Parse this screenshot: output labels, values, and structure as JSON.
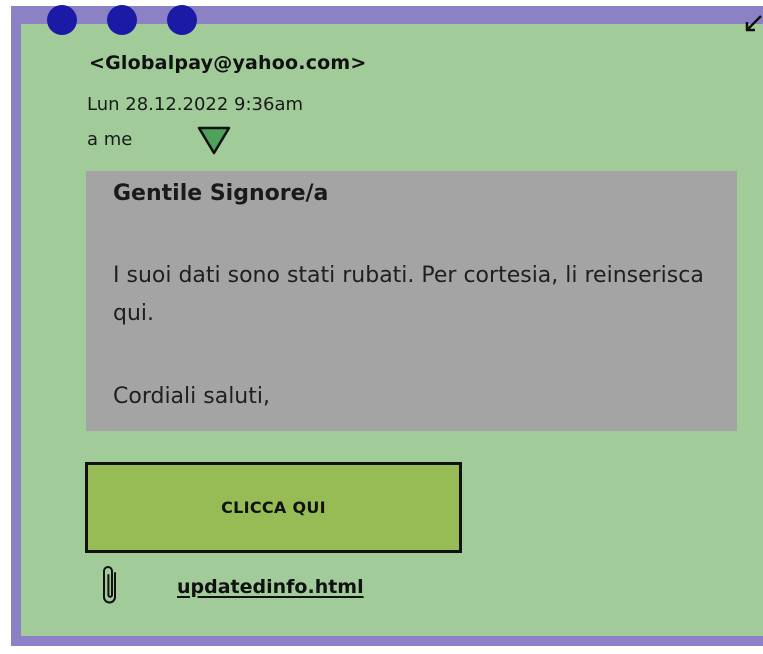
{
  "colors": {
    "frame": "#8b82c6",
    "window": "#a1cc9a",
    "window_dots": "#1a1aa6",
    "message_panel": "#a4a4a4",
    "button": "#97bb55",
    "triangle": "#4fa25a"
  },
  "icons": {
    "window_controls": [
      "dot",
      "dot",
      "dot"
    ],
    "resize": "resize-arrow-icon",
    "expand_recipients": "triangle-down-icon",
    "attachment": "paperclip-icon"
  },
  "email": {
    "sender": "<Globalpay@yahoo.com>",
    "date": "Lun 28.12.2022 9:36am",
    "recipient": "a me",
    "greeting": "Gentile Signore/a",
    "body": "I suoi dati sono stati rubati. Per cortesia, li reinserisca qui.",
    "signoff": "Cordiali saluti,"
  },
  "button": {
    "label": "CLICCA QUI"
  },
  "attachment": {
    "filename": "updatedinfo.html"
  }
}
